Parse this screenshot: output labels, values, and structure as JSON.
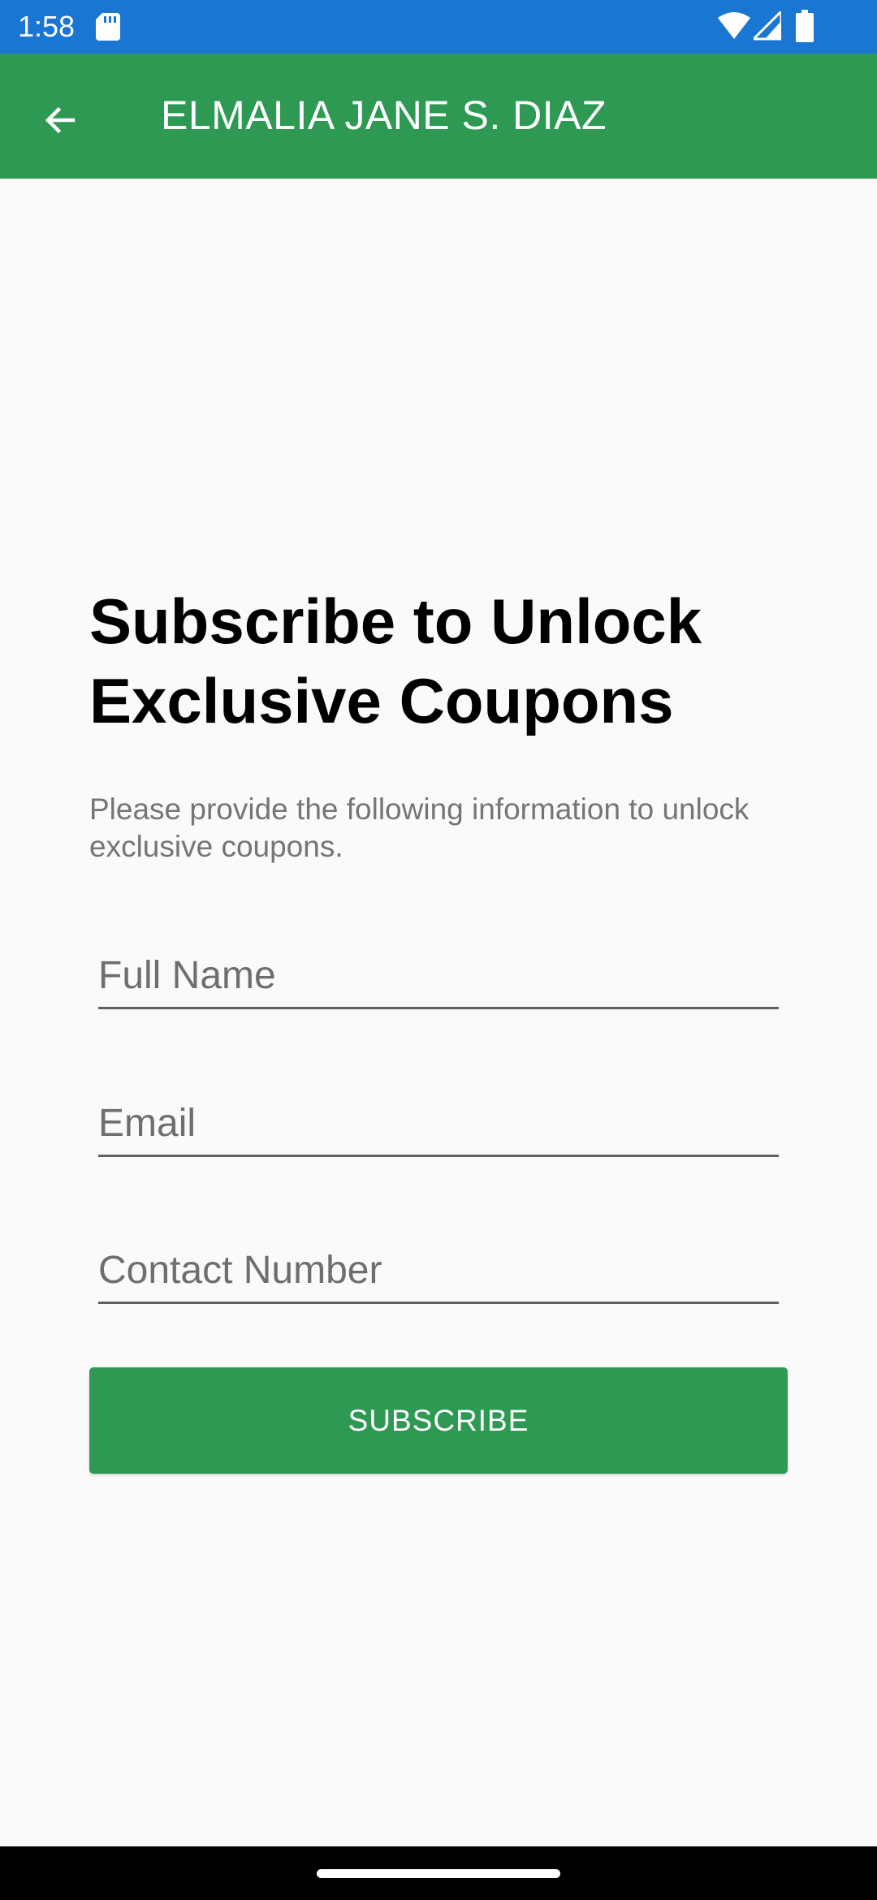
{
  "status_bar": {
    "time": "1:58",
    "background": "#1976d2",
    "icons": [
      "sd-card-icon",
      "wifi-icon",
      "cell-signal-icon",
      "battery-icon"
    ]
  },
  "app_bar": {
    "title": "ELMALIA JANE S. DIAZ",
    "background": "#2e9953",
    "back_icon": "arrow-back-icon"
  },
  "content": {
    "heading": "Subscribe to Unlock Exclusive Coupons",
    "subtitle": "Please provide the following information to unlock exclusive coupons."
  },
  "form": {
    "full_name": {
      "placeholder": "Full Name",
      "value": ""
    },
    "email": {
      "placeholder": "Email",
      "value": ""
    },
    "contact_number": {
      "placeholder": "Contact Number",
      "value": ""
    },
    "submit_label": "SUBSCRIBE",
    "submit_color": "#2e9953"
  }
}
